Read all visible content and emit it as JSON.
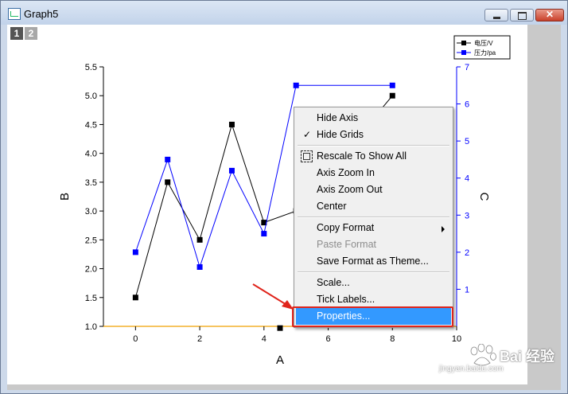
{
  "window": {
    "title": "Graph5",
    "close_glyph": "✕"
  },
  "tabs": [
    "1",
    "2"
  ],
  "legend": {
    "series": [
      "电压/V",
      "压力/pa"
    ]
  },
  "chart_data": {
    "type": "line",
    "xlabel": "A",
    "ylabel": "B",
    "y2label": "C",
    "xlim": [
      -1,
      10
    ],
    "ylim": [
      1.0,
      5.5
    ],
    "y2lim": [
      0,
      7
    ],
    "x_ticks": [
      "0",
      "2",
      "4",
      "6",
      "8",
      "10"
    ],
    "y_ticks": [
      "1.0",
      "1.5",
      "2.0",
      "2.5",
      "3.0",
      "3.5",
      "4.0",
      "4.5",
      "5.0",
      "5.5"
    ],
    "y2_ticks": [
      "1",
      "2",
      "3",
      "4",
      "5",
      "6",
      "7"
    ],
    "grid": false,
    "legend_position": "top-right",
    "series": [
      {
        "name": "电压/V",
        "axis": "left",
        "color": "#000000",
        "x": [
          0,
          1,
          2,
          3,
          4,
          5,
          8
        ],
        "values": [
          1.5,
          3.5,
          2.5,
          4.5,
          2.8,
          3.0,
          5.0
        ]
      },
      {
        "name": "压力/pa",
        "axis": "right",
        "color": "#0000ff",
        "x": [
          0,
          1,
          2,
          3,
          4,
          5,
          8
        ],
        "values": [
          2.0,
          4.5,
          1.6,
          4.2,
          2.5,
          6.5,
          6.5
        ]
      }
    ],
    "extra_point": {
      "x": 4.5,
      "y": 0.97
    }
  },
  "context_menu": {
    "items": [
      {
        "label": "Hide Axis"
      },
      {
        "label": "Hide Grids",
        "checked": true
      },
      {
        "separator": true
      },
      {
        "label": "Rescale To Show All",
        "icon": "rescale-icon"
      },
      {
        "label": "Axis Zoom In"
      },
      {
        "label": "Axis Zoom Out"
      },
      {
        "label": "Center"
      },
      {
        "separator": true
      },
      {
        "label": "Copy Format",
        "submenu": true
      },
      {
        "label": "Paste Format",
        "disabled": true
      },
      {
        "label": "Save Format as Theme..."
      },
      {
        "separator": true
      },
      {
        "label": "Scale..."
      },
      {
        "label": "Tick Labels..."
      },
      {
        "label": "Properties...",
        "highlighted": true
      }
    ]
  },
  "watermark": {
    "brand": "Bai 经验",
    "url": "jingyan.baidu.com"
  }
}
